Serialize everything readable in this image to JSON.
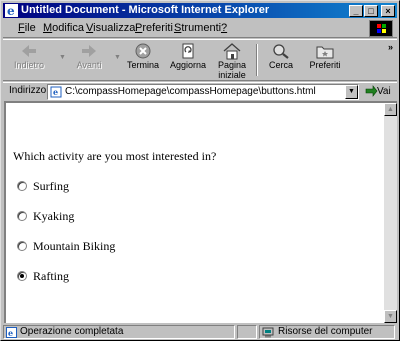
{
  "window": {
    "title": "Untitled Document - Microsoft Internet Explorer",
    "controls": [
      "_",
      "□",
      "×"
    ]
  },
  "menu": [
    {
      "key": "F",
      "rest": "ile"
    },
    {
      "key": "M",
      "rest": "odifica"
    },
    {
      "key": "V",
      "rest": "isualizza"
    },
    {
      "key": "P",
      "rest": "referiti"
    },
    {
      "key": "S",
      "rest": "trumenti"
    },
    {
      "key": "?",
      "rest": ""
    }
  ],
  "toolbar": {
    "back": "Indietro",
    "forward": "Avanti",
    "stop": "Termina",
    "refresh": "Aggiorna",
    "home_line1": "Pagina",
    "home_line2": "iniziale",
    "search": "Cerca",
    "favorites": "Preferiti",
    "more": "»"
  },
  "address": {
    "label": "Indirizzo",
    "url": "C:\\compassHomepage\\compassHomepage\\buttons.html",
    "go": "Vai"
  },
  "page": {
    "question": "Which activity are you most interested in?",
    "options": [
      {
        "label": "Surfing",
        "checked": false
      },
      {
        "label": "Kyaking",
        "checked": false
      },
      {
        "label": "Mountain Biking",
        "checked": false
      },
      {
        "label": "Rafting",
        "checked": true
      }
    ]
  },
  "status": {
    "message": "Operazione completata",
    "zone": "Risorse del computer"
  },
  "colors": {
    "titlebar_start": "#000080",
    "titlebar_end": "#1084d0",
    "chrome": "#c0c0c0"
  }
}
